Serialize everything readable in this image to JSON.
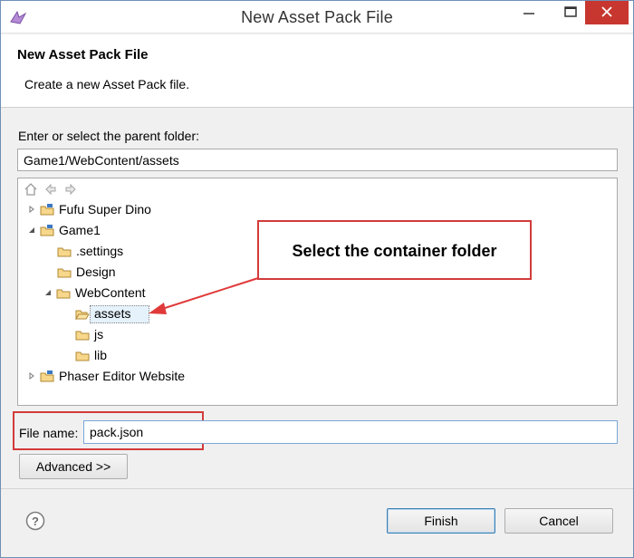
{
  "window": {
    "title": "New Asset Pack File",
    "icons": {
      "app": "phaser-editor-icon",
      "minimize": "minimize-icon",
      "maximize": "maximize-icon",
      "close": "close-icon"
    }
  },
  "header": {
    "title": "New Asset Pack File",
    "description": "Create a new Asset Pack file."
  },
  "parent_folder": {
    "label": "Enter or select the parent folder:",
    "value": "Game1/WebContent/assets"
  },
  "tree": {
    "toolbar_icons": [
      "home-icon",
      "back-icon",
      "forward-icon"
    ],
    "items": [
      {
        "label": "Fufu Super Dino",
        "expanded": false,
        "type": "project"
      },
      {
        "label": "Game1",
        "expanded": true,
        "type": "project"
      },
      {
        "label": ".settings",
        "type": "folder"
      },
      {
        "label": "Design",
        "type": "folder"
      },
      {
        "label": "WebContent",
        "expanded": true,
        "type": "folder"
      },
      {
        "label": "assets",
        "type": "folder",
        "selected": true
      },
      {
        "label": "js",
        "type": "folder"
      },
      {
        "label": "lib",
        "type": "folder"
      },
      {
        "label": "Phaser Editor Website",
        "expanded": false,
        "type": "project"
      }
    ]
  },
  "annotation": {
    "text": "Select the container folder",
    "color": "#d23b3b"
  },
  "file_name": {
    "label": "File name:",
    "value": "pack.json"
  },
  "buttons": {
    "advanced": "Advanced >>",
    "finish": "Finish",
    "cancel": "Cancel",
    "help_icon": "help-icon"
  }
}
